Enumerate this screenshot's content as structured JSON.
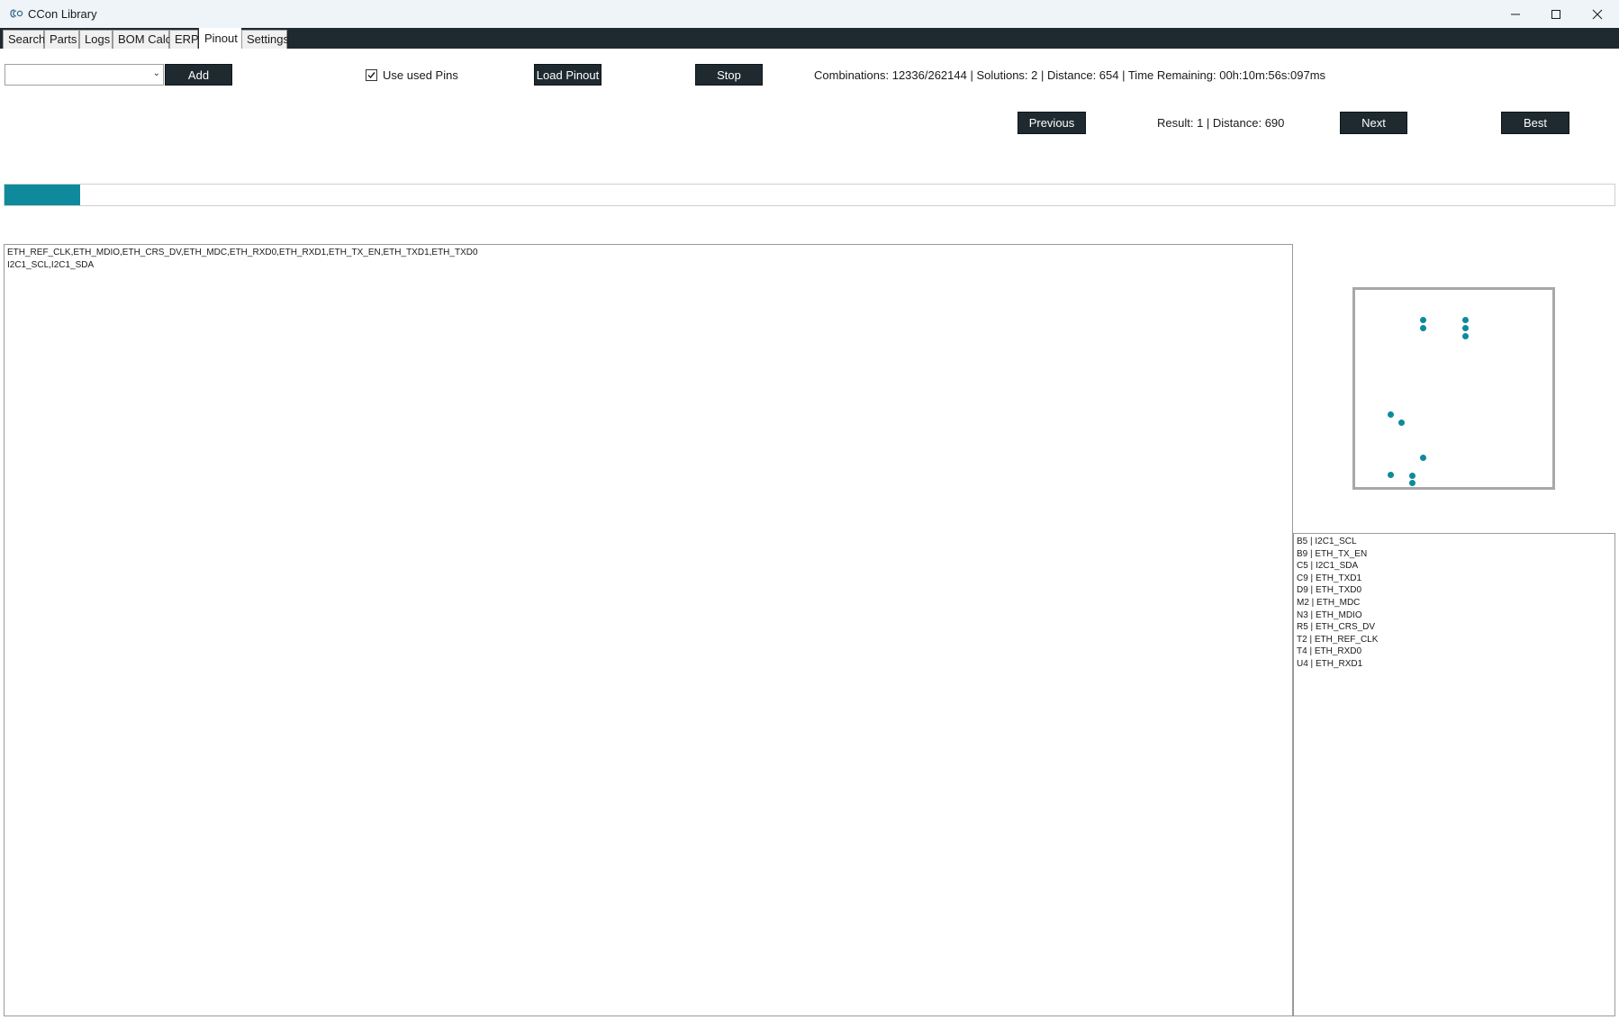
{
  "window": {
    "title": "CCon Library"
  },
  "tabs": [
    {
      "label": "Search"
    },
    {
      "label": "Parts"
    },
    {
      "label": "Logs"
    },
    {
      "label": "BOM Calc"
    },
    {
      "label": "ERP"
    },
    {
      "label": "Pinout",
      "active": true
    },
    {
      "label": "Settings"
    }
  ],
  "toolbar": {
    "combo_value": "",
    "add_label": "Add",
    "use_used_pins_label": "Use used Pins",
    "use_used_pins_checked": true,
    "load_pinout_label": "Load Pinout",
    "stop_label": "Stop",
    "status": "Combinations: 12336/262144 | Solutions: 2 | Distance: 654 | Time Remaining: 00h:10m:56s:097ms"
  },
  "navigation": {
    "previous_label": "Previous",
    "result_text": "Result: 1 | Distance: 690",
    "next_label": "Next",
    "best_label": "Best"
  },
  "progress": {
    "value": 0.047
  },
  "requirements_text": "ETH_REF_CLK,ETH_MDIO,ETH_CRS_DV,ETH_MDC,ETH_RXD0,ETH_RXD1,ETH_TX_EN,ETH_TXD1,ETH_TXD0\nI2C1_SCL,I2C1_SDA",
  "pin_assignments": [
    "B5 | I2C1_SCL",
    "B9 | ETH_TX_EN",
    "C5 | I2C1_SDA",
    "C9 | ETH_TXD1",
    "D9 | ETH_TXD0",
    "M2 | ETH_MDC",
    "N3 | ETH_MDIO",
    "R5 | ETH_CRS_DV",
    "T2 | ETH_REF_CLK",
    "T4 | ETH_RXD0",
    "U4 | ETH_RXD1"
  ],
  "colors": {
    "accent": "#0e8a9c",
    "dark": "#1f2a30"
  },
  "icons": {
    "app": "ccon-logo-icon",
    "minimize": "minimize-icon",
    "maximize": "maximize-icon",
    "close": "close-icon",
    "dropdown": "chevron-down-icon",
    "check": "checkmark-icon"
  }
}
